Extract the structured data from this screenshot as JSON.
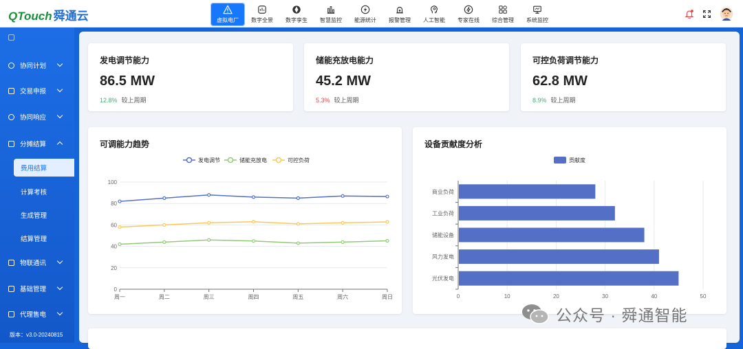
{
  "header": {
    "logo_en": "QTouch",
    "logo_cn": "舜通云",
    "nav": [
      {
        "label": "虚拟电厂",
        "icon": "warning-icon",
        "active": true
      },
      {
        "label": "数字全景",
        "icon": "panorama-icon"
      },
      {
        "label": "数字孪生",
        "icon": "aperture-icon"
      },
      {
        "label": "智慧监控",
        "icon": "bar-chart-icon"
      },
      {
        "label": "能源统计",
        "icon": "lightning-icon"
      },
      {
        "label": "报警管理",
        "icon": "alarm-icon"
      },
      {
        "label": "人工智能",
        "icon": "ai-head-icon"
      },
      {
        "label": "专家在线",
        "icon": "expert-bolt-icon"
      },
      {
        "label": "综合管理",
        "icon": "grid-icon"
      },
      {
        "label": "系统监控",
        "icon": "monitor-icon"
      }
    ]
  },
  "sidebar": {
    "items": [
      {
        "label": "协同计划",
        "icon": "gear-icon"
      },
      {
        "label": "交易申报",
        "icon": "document-icon"
      },
      {
        "label": "协同响应",
        "icon": "gears-icon"
      },
      {
        "label": "分摊结算",
        "icon": "settlement-icon"
      }
    ],
    "subitems": [
      {
        "label": "费用结算",
        "active": true
      },
      {
        "label": "计算考核"
      },
      {
        "label": "生成管理"
      },
      {
        "label": "结算管理"
      }
    ],
    "items_bottom": [
      {
        "label": "物联通讯",
        "icon": "iot-icon"
      },
      {
        "label": "基础管理",
        "icon": "base-icon"
      },
      {
        "label": "代理售电",
        "icon": "sale-icon"
      }
    ],
    "version": "版本：v3.0-20240815"
  },
  "stats": [
    {
      "title": "发电调节能力",
      "value": "86.5 MW",
      "change": "12.8%",
      "change_color": "#3bb273",
      "change_label": "较上周期"
    },
    {
      "title": "储能充放电能力",
      "value": "45.2 MW",
      "change": "5.3%",
      "change_color": "#e5484d",
      "change_label": "较上周期"
    },
    {
      "title": "可控负荷调节能力",
      "value": "62.8 MW",
      "change": "8.9%",
      "change_color": "#3bb273",
      "change_label": "较上周期"
    }
  ],
  "trend": {
    "title": "可调能力趋势",
    "chart_data": {
      "type": "line",
      "categories": [
        "周一",
        "周二",
        "周三",
        "周四",
        "周五",
        "周六",
        "周日"
      ],
      "series": [
        {
          "name": "发电调节",
          "values": [
            82,
            85,
            88,
            86,
            85,
            87,
            86.5
          ],
          "color": "#5470c6"
        },
        {
          "name": "储能充放电",
          "values": [
            42,
            44,
            46,
            45,
            43,
            44,
            45.2
          ],
          "color": "#91cc75"
        },
        {
          "name": "可控负荷",
          "values": [
            58,
            60,
            62,
            63,
            61,
            62,
            62.8
          ],
          "color": "#fac858"
        }
      ],
      "ylim": [
        0,
        100
      ],
      "yticks": [
        0,
        20,
        40,
        60,
        80,
        100
      ],
      "grid": true,
      "legend": "top-center"
    }
  },
  "contribution": {
    "title": "设备贡献度分析",
    "chart_data": {
      "type": "bar",
      "orientation": "horizontal",
      "categories": [
        "光伏发电",
        "风力发电",
        "储能设备",
        "工业负荷",
        "商业负荷"
      ],
      "series": [
        {
          "name": "贡献度",
          "values": [
            45,
            41,
            38,
            32,
            28
          ],
          "color": "#5470c6"
        }
      ],
      "xlim": [
        0,
        50
      ],
      "xticks": [
        0,
        10,
        20,
        30,
        40,
        50
      ],
      "grid": true,
      "legend": "top-center"
    }
  },
  "watermark": "公众号 · 舜通智能"
}
